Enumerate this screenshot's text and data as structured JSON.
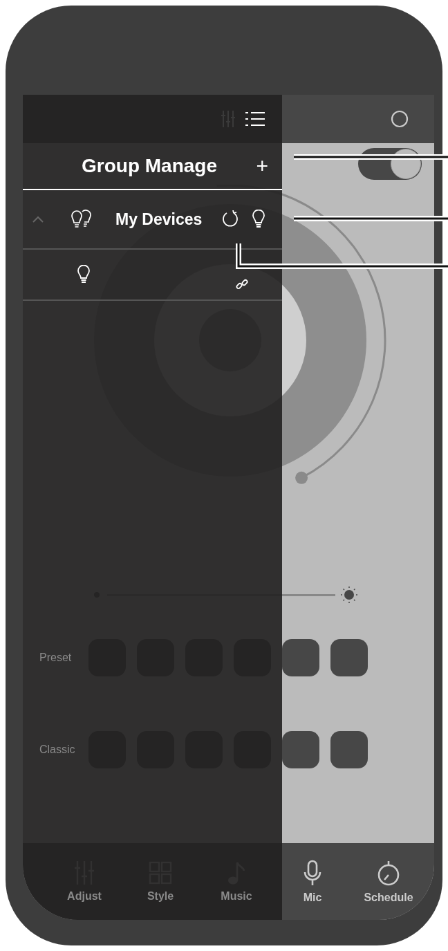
{
  "drawer": {
    "title": "Group Manage",
    "add_button": "+",
    "groups": [
      {
        "name": "My Devices",
        "expanded": true,
        "devices": [
          {
            "kind": "bulb"
          }
        ]
      }
    ]
  },
  "power_toggle": {
    "on": true
  },
  "brightness": {
    "level": 1
  },
  "palettes": [
    {
      "label": "Preset"
    },
    {
      "label": "Classic"
    }
  ],
  "tabs": [
    {
      "label": "Adjust",
      "kind": "sliders"
    },
    {
      "label": "Style",
      "kind": "grid"
    },
    {
      "label": "Music",
      "kind": "note"
    },
    {
      "label": "Mic",
      "kind": "mic"
    },
    {
      "label": "Schedule",
      "kind": "timer"
    }
  ]
}
